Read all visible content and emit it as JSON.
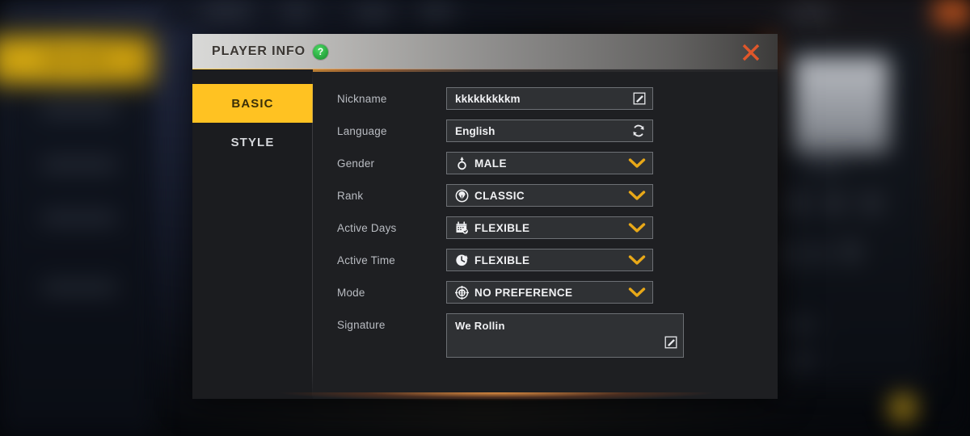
{
  "dialog": {
    "title": "PLAYER INFO",
    "help_icon": "help-question-icon",
    "close_icon": "close-icon",
    "accent_color": "#ffc222",
    "close_color": "#e0572a",
    "help_color": "#2ba23c"
  },
  "sidebar": {
    "tabs": [
      {
        "label": "BASIC",
        "active": true
      },
      {
        "label": "STYLE",
        "active": false
      }
    ]
  },
  "form": {
    "nickname": {
      "label": "Nickname",
      "value": "kkkkkkkkkm",
      "trailing_icon": "edit-pencil-icon"
    },
    "language": {
      "label": "Language",
      "value": "English",
      "trailing_icon": "refresh-swap-icon"
    },
    "gender": {
      "label": "Gender",
      "value": "MALE",
      "leading_icon": "male-symbol-icon",
      "trailing_icon": "chevron-down-icon"
    },
    "rank": {
      "label": "Rank",
      "value": "CLASSIC",
      "leading_icon": "rank-badge-icon",
      "trailing_icon": "chevron-down-icon"
    },
    "active_days": {
      "label": "Active Days",
      "value": "FLEXIBLE",
      "leading_icon": "calendar-icon",
      "trailing_icon": "chevron-down-icon"
    },
    "active_time": {
      "label": "Active Time",
      "value": "FLEXIBLE",
      "leading_icon": "clock-icon",
      "trailing_icon": "chevron-down-icon"
    },
    "mode": {
      "label": "Mode",
      "value": "NO PREFERENCE",
      "leading_icon": "crosshair-scope-icon",
      "trailing_icon": "chevron-down-icon"
    },
    "signature": {
      "label": "Signature",
      "value": "We Rollin",
      "trailing_icon": "edit-pencil-icon"
    }
  }
}
